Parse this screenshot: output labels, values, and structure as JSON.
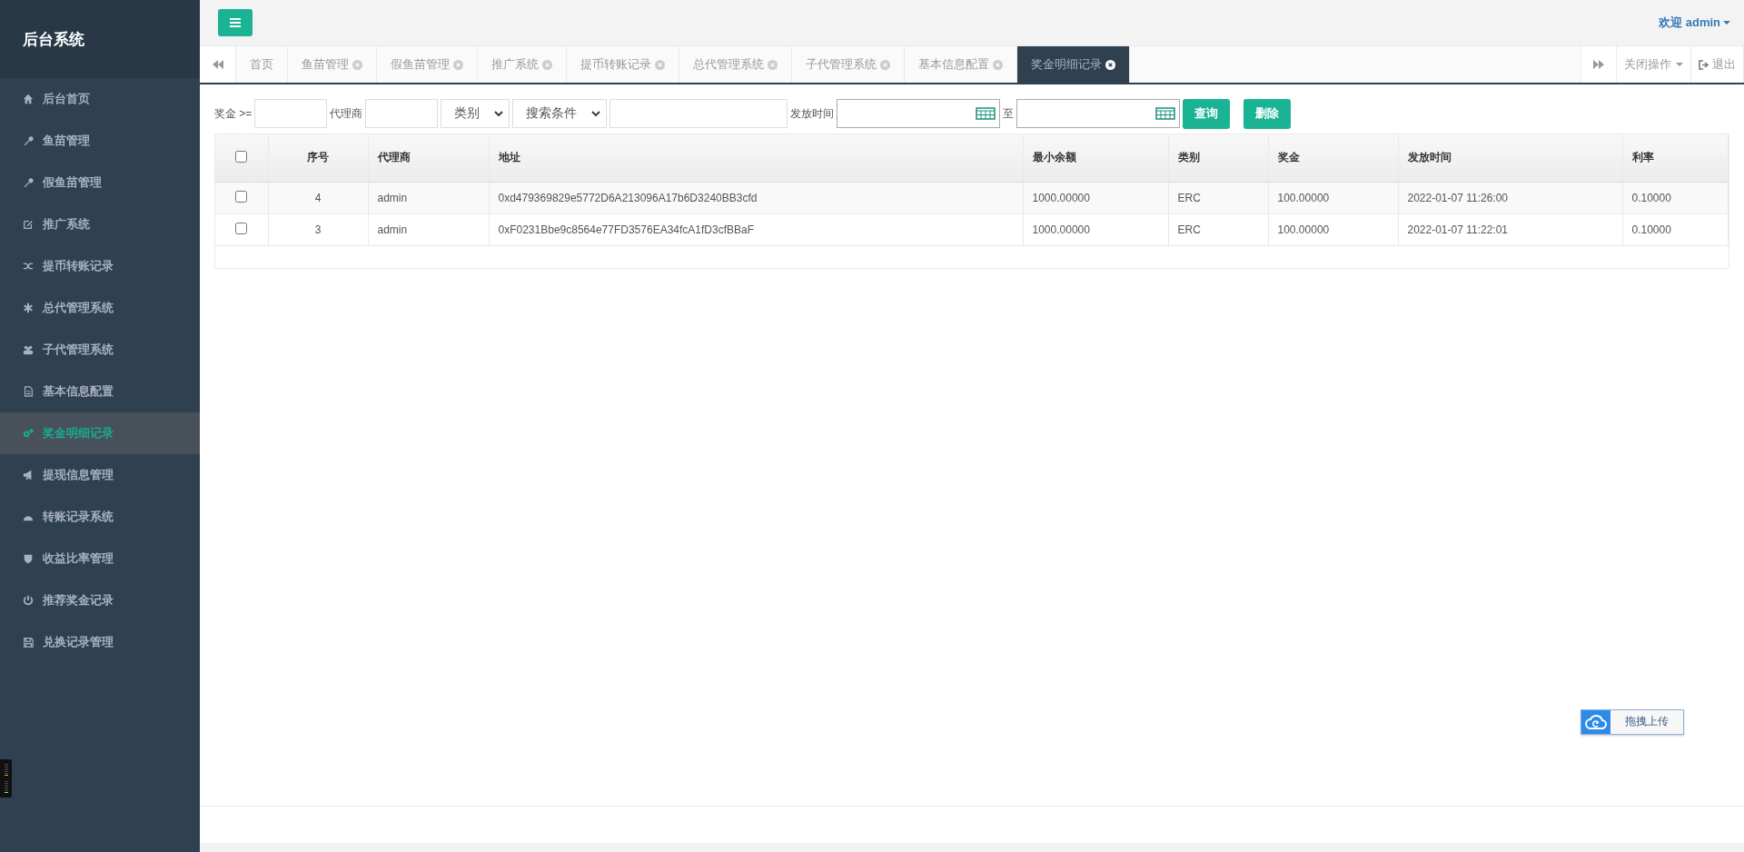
{
  "sidebar": {
    "title": "后台系统",
    "items": [
      {
        "label": "后台首页",
        "selected": false
      },
      {
        "label": "鱼苗管理",
        "selected": false
      },
      {
        "label": "假鱼苗管理",
        "selected": false
      },
      {
        "label": "推广系统",
        "selected": false
      },
      {
        "label": "提币转账记录",
        "selected": false
      },
      {
        "label": "总代管理系统",
        "selected": false
      },
      {
        "label": "子代管理系统",
        "selected": false
      },
      {
        "label": "基本信息配置",
        "selected": false
      },
      {
        "label": "奖金明细记录",
        "selected": true
      },
      {
        "label": "提现信息管理",
        "selected": false
      },
      {
        "label": "转账记录系统",
        "selected": false
      },
      {
        "label": "收益比率管理",
        "selected": false
      },
      {
        "label": "推荐奖金记录",
        "selected": false
      },
      {
        "label": "兑换记录管理",
        "selected": false
      }
    ]
  },
  "header": {
    "user": "欢迎 admin"
  },
  "tabs": [
    {
      "label": "首页",
      "selected": false,
      "closable": false
    },
    {
      "label": "鱼苗管理",
      "selected": false,
      "closable": true
    },
    {
      "label": "假鱼苗管理",
      "selected": false,
      "closable": true
    },
    {
      "label": "推广系统",
      "selected": false,
      "closable": true
    },
    {
      "label": "提币转账记录",
      "selected": false,
      "closable": true
    },
    {
      "label": "总代管理系统",
      "selected": false,
      "closable": true
    },
    {
      "label": "子代管理系统",
      "selected": false,
      "closable": true
    },
    {
      "label": "基本信息配置",
      "selected": false,
      "closable": true
    },
    {
      "label": "奖金明细记录",
      "selected": true,
      "closable": true
    }
  ],
  "tab_actions": {
    "close_menu": "关闭操作",
    "logout": "退出"
  },
  "filters": {
    "bonus_label": "奖金 >=",
    "agent_label": "代理商",
    "category_select": "类别",
    "condition_select": "搜索条件",
    "time_label": "发放时间",
    "to_label": "至",
    "search_button": "查询",
    "delete_button": "删除"
  },
  "table": {
    "header_checked": false,
    "columns": [
      "序号",
      "代理商",
      "地址",
      "最小余额",
      "类别",
      "奖金",
      "发放时间",
      "利率"
    ],
    "rows": [
      {
        "checked": false,
        "cells": [
          "4",
          "admin",
          "0xd479369829e5772D6A213096A17b6D3240BB3cfd",
          "1000.00000",
          "ERC",
          "100.00000",
          "2022-01-07 11:26:00",
          "0.10000"
        ]
      },
      {
        "checked": false,
        "cells": [
          "3",
          "admin",
          "0xF0231Bbe9c8564e77FD3576EA34fcA1fD3cfBBaF",
          "1000.00000",
          "ERC",
          "100.00000",
          "2022-01-07 11:22:01",
          "0.10000"
        ]
      }
    ]
  },
  "upload_button": "拖拽上传"
}
